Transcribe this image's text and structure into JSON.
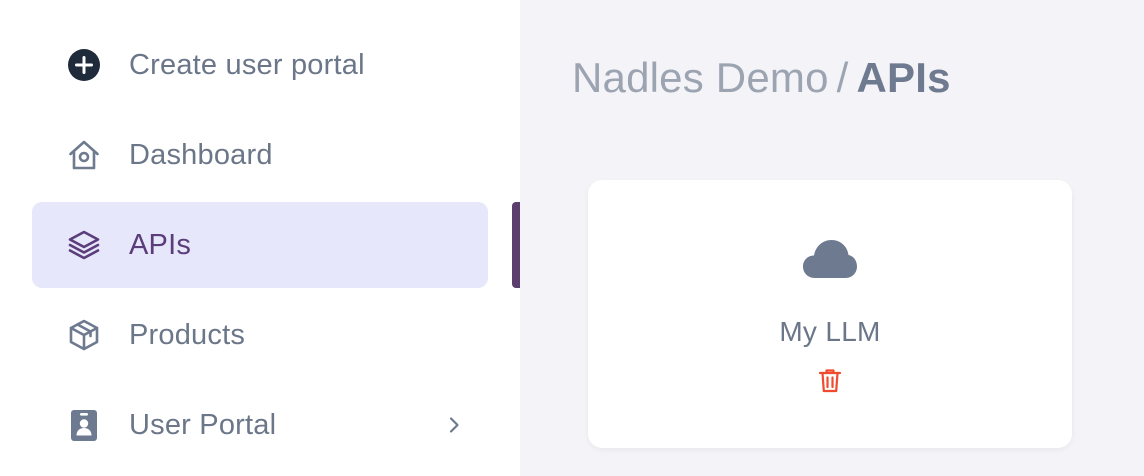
{
  "sidebar": {
    "items": [
      {
        "label": "Create user portal",
        "icon": "plus-circle-icon"
      },
      {
        "label": "Dashboard",
        "icon": "home-icon"
      },
      {
        "label": "APIs",
        "icon": "layers-icon",
        "active": true
      },
      {
        "label": "Products",
        "icon": "package-icon"
      },
      {
        "label": "User Portal",
        "icon": "id-badge-icon",
        "expandable": true
      }
    ]
  },
  "breadcrumb": {
    "parent": "Nadles Demo",
    "separator": "/",
    "current": "APIs"
  },
  "api_card": {
    "name": "My LLM",
    "icon": "cloud-icon",
    "delete_icon": "trash-icon"
  },
  "colors": {
    "accent": "#5b3d7a",
    "active_bg": "#e6e7fb",
    "danger": "#f04a2f",
    "icon_gray": "#6e7a8f"
  }
}
